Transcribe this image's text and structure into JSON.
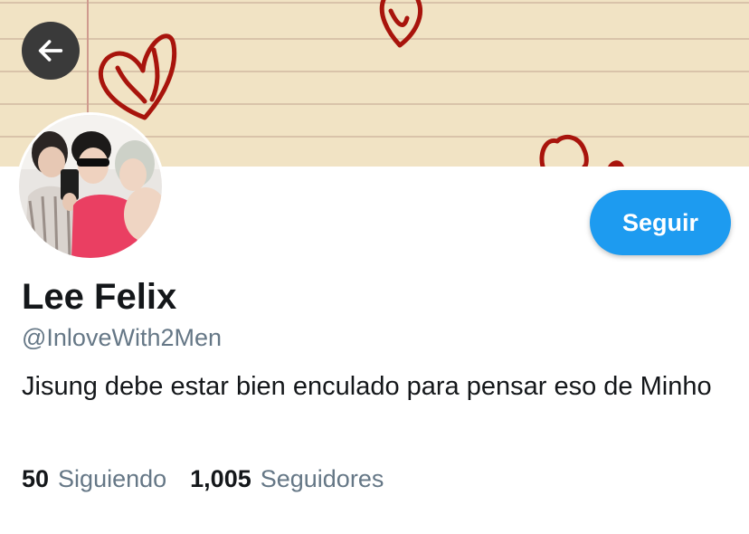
{
  "profile": {
    "display_name": "Lee Felix",
    "handle": "@InloveWith2Men",
    "bio": "Jisung debe estar bien enculado para pensar eso de Minho",
    "avatar_description": "selfie of three people"
  },
  "actions": {
    "follow_label": "Seguir",
    "back_icon": "arrow-left-icon"
  },
  "stats": {
    "following_count": "50",
    "following_label": "Siguiendo",
    "followers_count": "1,005",
    "followers_label": "Seguidores"
  },
  "colors": {
    "accent": "#1d9bf0",
    "banner_paper": "#f1e3c4",
    "heart": "#a8140c",
    "secondary_text": "#657786"
  }
}
